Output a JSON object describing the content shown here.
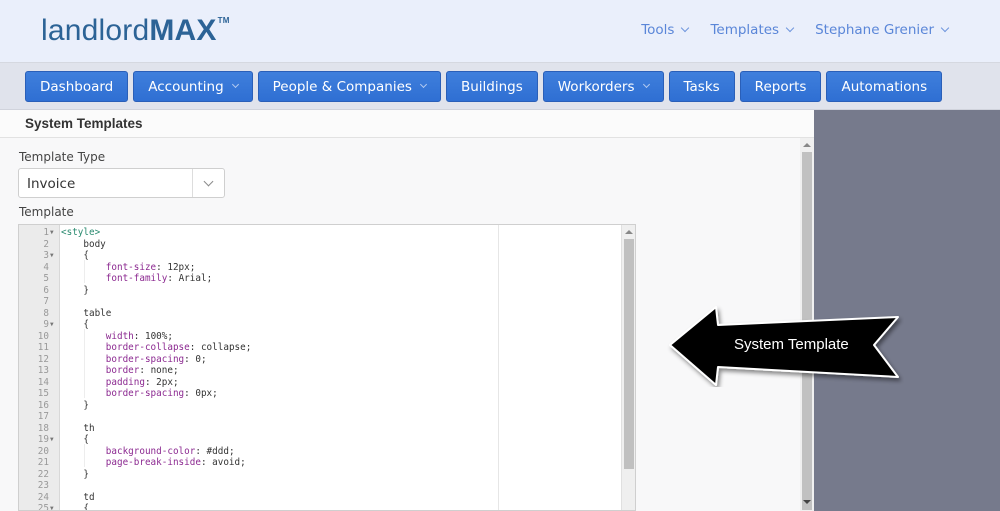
{
  "app": {
    "logo_light": "landlord",
    "logo_bold": "MAX",
    "logo_tm": "TM"
  },
  "topnav": [
    {
      "label": "Tools",
      "has_dropdown": true
    },
    {
      "label": "Templates",
      "has_dropdown": true
    },
    {
      "label": "Stephane Grenier",
      "has_dropdown": true
    }
  ],
  "navbar": [
    {
      "label": "Dashboard",
      "has_dropdown": false
    },
    {
      "label": "Accounting",
      "has_dropdown": true
    },
    {
      "label": "People & Companies",
      "has_dropdown": true
    },
    {
      "label": "Buildings",
      "has_dropdown": false
    },
    {
      "label": "Workorders",
      "has_dropdown": true
    },
    {
      "label": "Tasks",
      "has_dropdown": false
    },
    {
      "label": "Reports",
      "has_dropdown": false
    },
    {
      "label": "Automations",
      "has_dropdown": false
    }
  ],
  "page": {
    "title": "System Templates",
    "template_type_label": "Template Type",
    "template_type_value": "Invoice",
    "template_label": "Template"
  },
  "editor": {
    "lines": [
      {
        "n": 1,
        "fold": true,
        "tokens": [
          [
            "tag",
            "<style>"
          ]
        ]
      },
      {
        "n": 2,
        "fold": false,
        "tokens": [
          [
            "sel",
            "    body"
          ]
        ]
      },
      {
        "n": 3,
        "fold": true,
        "tokens": [
          [
            "punc",
            "    {"
          ]
        ]
      },
      {
        "n": 4,
        "fold": false,
        "tokens": [
          [
            "sel",
            "        "
          ],
          [
            "prop",
            "font-size"
          ],
          [
            "punc",
            ": "
          ],
          [
            "val",
            "12px"
          ],
          [
            "punc",
            ";"
          ]
        ]
      },
      {
        "n": 5,
        "fold": false,
        "tokens": [
          [
            "sel",
            "        "
          ],
          [
            "prop",
            "font-family"
          ],
          [
            "punc",
            ": "
          ],
          [
            "val",
            "Arial"
          ],
          [
            "punc",
            ";"
          ]
        ]
      },
      {
        "n": 6,
        "fold": false,
        "tokens": [
          [
            "punc",
            "    }"
          ]
        ]
      },
      {
        "n": 7,
        "fold": false,
        "tokens": []
      },
      {
        "n": 8,
        "fold": false,
        "tokens": [
          [
            "sel",
            "    table"
          ]
        ]
      },
      {
        "n": 9,
        "fold": true,
        "tokens": [
          [
            "punc",
            "    {"
          ]
        ]
      },
      {
        "n": 10,
        "fold": false,
        "tokens": [
          [
            "sel",
            "        "
          ],
          [
            "prop",
            "width"
          ],
          [
            "punc",
            ": "
          ],
          [
            "val",
            "100%"
          ],
          [
            "punc",
            ";"
          ]
        ]
      },
      {
        "n": 11,
        "fold": false,
        "tokens": [
          [
            "sel",
            "        "
          ],
          [
            "prop",
            "border-collapse"
          ],
          [
            "punc",
            ": "
          ],
          [
            "val",
            "collapse"
          ],
          [
            "punc",
            ";"
          ]
        ]
      },
      {
        "n": 12,
        "fold": false,
        "tokens": [
          [
            "sel",
            "        "
          ],
          [
            "prop",
            "border-spacing"
          ],
          [
            "punc",
            ": "
          ],
          [
            "val",
            "0"
          ],
          [
            "punc",
            ";"
          ]
        ]
      },
      {
        "n": 13,
        "fold": false,
        "tokens": [
          [
            "sel",
            "        "
          ],
          [
            "prop",
            "border"
          ],
          [
            "punc",
            ": "
          ],
          [
            "val",
            "none"
          ],
          [
            "punc",
            ";"
          ]
        ]
      },
      {
        "n": 14,
        "fold": false,
        "tokens": [
          [
            "sel",
            "        "
          ],
          [
            "prop",
            "padding"
          ],
          [
            "punc",
            ": "
          ],
          [
            "val",
            "2px"
          ],
          [
            "punc",
            ";"
          ]
        ]
      },
      {
        "n": 15,
        "fold": false,
        "tokens": [
          [
            "sel",
            "        "
          ],
          [
            "prop",
            "border-spacing"
          ],
          [
            "punc",
            ": "
          ],
          [
            "val",
            "0px"
          ],
          [
            "punc",
            ";"
          ]
        ]
      },
      {
        "n": 16,
        "fold": false,
        "tokens": [
          [
            "punc",
            "    }"
          ]
        ]
      },
      {
        "n": 17,
        "fold": false,
        "tokens": []
      },
      {
        "n": 18,
        "fold": false,
        "tokens": [
          [
            "sel",
            "    th"
          ]
        ]
      },
      {
        "n": 19,
        "fold": true,
        "tokens": [
          [
            "punc",
            "    {"
          ]
        ]
      },
      {
        "n": 20,
        "fold": false,
        "tokens": [
          [
            "sel",
            "        "
          ],
          [
            "prop",
            "background-color"
          ],
          [
            "punc",
            ": "
          ],
          [
            "val",
            "#ddd"
          ],
          [
            "punc",
            ";"
          ]
        ]
      },
      {
        "n": 21,
        "fold": false,
        "tokens": [
          [
            "sel",
            "        "
          ],
          [
            "prop",
            "page-break-inside"
          ],
          [
            "punc",
            ": "
          ],
          [
            "val",
            "avoid"
          ],
          [
            "punc",
            ";"
          ]
        ]
      },
      {
        "n": 22,
        "fold": false,
        "tokens": [
          [
            "punc",
            "    }"
          ]
        ]
      },
      {
        "n": 23,
        "fold": false,
        "tokens": []
      },
      {
        "n": 24,
        "fold": false,
        "tokens": [
          [
            "sel",
            "    td"
          ]
        ]
      },
      {
        "n": 25,
        "fold": true,
        "tokens": [
          [
            "punc",
            "    {"
          ]
        ]
      }
    ]
  },
  "callout": {
    "text": "System Template"
  },
  "colors": {
    "brand": "#2c6396",
    "nav_button": "#3576d8",
    "topnav_link": "#5a86d8",
    "side_panel": "#767a8c"
  }
}
